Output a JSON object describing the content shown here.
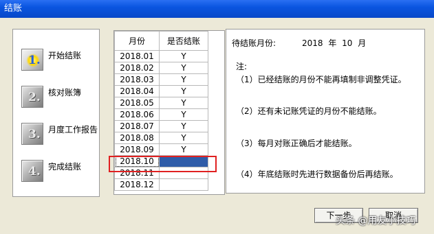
{
  "window": {
    "title": "结账"
  },
  "steps": [
    {
      "num": "1.",
      "label": "开始结账",
      "active": true
    },
    {
      "num": "2.",
      "label": "核对账簿",
      "active": false
    },
    {
      "num": "3.",
      "label": "月度工作报告",
      "active": false
    },
    {
      "num": "4.",
      "label": "完成结账",
      "active": false
    }
  ],
  "table": {
    "headers": {
      "month": "月份",
      "closed": "是否结账"
    },
    "rows": [
      {
        "month": "2018.01",
        "closed": "Y"
      },
      {
        "month": "2018.02",
        "closed": "Y"
      },
      {
        "month": "2018.03",
        "closed": "Y"
      },
      {
        "month": "2018.04",
        "closed": "Y"
      },
      {
        "month": "2018.05",
        "closed": "Y"
      },
      {
        "month": "2018.06",
        "closed": "Y"
      },
      {
        "month": "2018.07",
        "closed": "Y"
      },
      {
        "month": "2018.08",
        "closed": "Y"
      },
      {
        "month": "2018.09",
        "closed": "Y"
      },
      {
        "month": "2018.10",
        "closed": ""
      },
      {
        "month": "2018.11",
        "closed": ""
      },
      {
        "month": "2018.12",
        "closed": ""
      }
    ],
    "selected_row": "2018.10"
  },
  "info": {
    "pending_label": "待结账月份:",
    "pending_value": "2018 年 10 月",
    "notes_title": "注:",
    "notes": [
      "（1）已经结账的月份不能再填制非调整凭证。",
      "（2）还有未记账凭证的月份不能结账。",
      "（3）每月对账正确后才能结账。",
      "（4）年底结账时先进行数据备份后再结账。"
    ]
  },
  "buttons": {
    "next": "下一步",
    "cancel": "取消"
  },
  "watermark": "头条 @用友小技巧",
  "colors": {
    "titlebar": "#0a55e0",
    "selection": "#2f5ca8",
    "highlight": "#e02020"
  }
}
